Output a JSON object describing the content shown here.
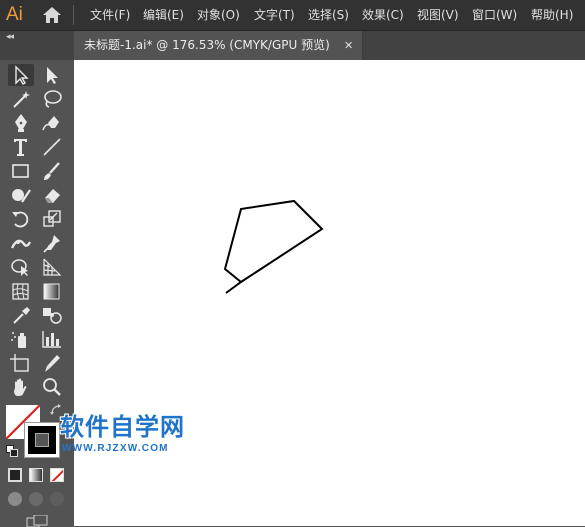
{
  "app": {
    "logo_text": "Ai"
  },
  "menu": {
    "items": [
      {
        "label": "文件(F)"
      },
      {
        "label": "编辑(E)"
      },
      {
        "label": "对象(O)"
      },
      {
        "label": "文字(T)"
      },
      {
        "label": "选择(S)"
      },
      {
        "label": "效果(C)"
      },
      {
        "label": "视图(V)"
      },
      {
        "label": "窗口(W)"
      },
      {
        "label": "帮助(H)"
      }
    ]
  },
  "document_tab": {
    "title": "未标题-1.ai* @ 176.53% (CMYK/GPU 预览)",
    "close_glyph": "✕"
  },
  "toolbar": {
    "collapse_glyph": "◂◂",
    "tools": [
      "selection-tool-icon",
      "direct-selection-tool-icon",
      "magic-wand-tool-icon",
      "lasso-tool-icon",
      "pen-tool-icon",
      "curvature-tool-icon",
      "type-tool-icon",
      "line-segment-tool-icon",
      "rectangle-tool-icon",
      "paintbrush-tool-icon",
      "shaper-tool-icon",
      "eraser-tool-icon",
      "rotate-tool-icon",
      "scale-tool-icon",
      "width-tool-icon",
      "puppet-warp-tool-icon",
      "shape-builder-tool-icon",
      "perspective-grid-tool-icon",
      "mesh-tool-icon",
      "gradient-tool-icon",
      "eyedropper-tool-icon",
      "blend-tool-icon",
      "symbol-sprayer-tool-icon",
      "column-graph-tool-icon",
      "artboard-tool-icon",
      "slice-tool-icon",
      "hand-tool-icon",
      "zoom-tool-icon"
    ],
    "fill_color": "none",
    "stroke_color": "#000000"
  },
  "canvas": {
    "background": "#ffffff",
    "stroke_color": "#000000"
  },
  "watermark": {
    "title": "软件自学网",
    "url": "WWW.RJZXW.COM",
    "color": "#1f74c9"
  }
}
